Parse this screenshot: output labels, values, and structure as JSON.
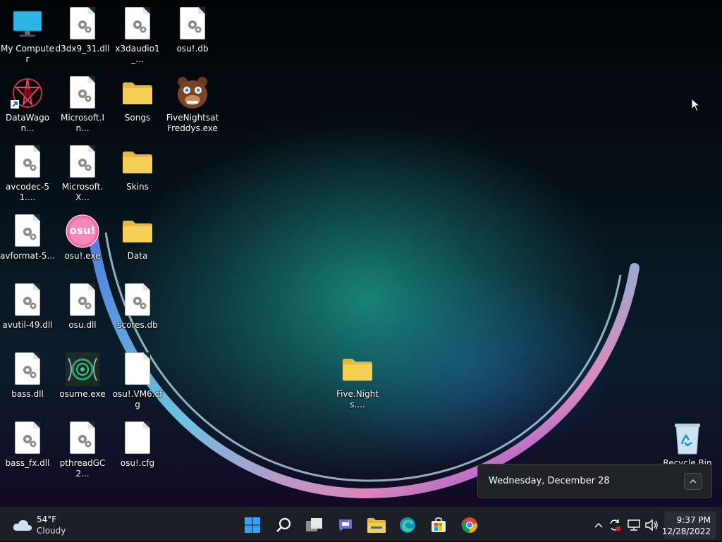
{
  "desktop": {
    "icons": [
      {
        "label": "My Computer"
      },
      {
        "label": "d3dx9_31.dll"
      },
      {
        "label": "x3daudio1_..."
      },
      {
        "label": "osu!.db"
      },
      {
        "label": "DataWagon..."
      },
      {
        "label": "Microsoft.In..."
      },
      {
        "label": "Songs"
      },
      {
        "label": "FiveNightsatFreddys.exe"
      },
      {
        "label": "avcodec-51...."
      },
      {
        "label": "Microsoft.X..."
      },
      {
        "label": "Skins"
      },
      {
        "label": "avformat-5..."
      },
      {
        "label": "osu!.exe"
      },
      {
        "label": "Data"
      },
      {
        "label": "avutil-49.dll"
      },
      {
        "label": "osu.dll"
      },
      {
        "label": "scores.db"
      },
      {
        "label": "bass.dll"
      },
      {
        "label": "osume.exe"
      },
      {
        "label": "osu!.VM6.cfg"
      },
      {
        "label": "bass_fx.dll"
      },
      {
        "label": "pthreadGC2..."
      },
      {
        "label": "osu!.cfg"
      },
      {
        "label": "Five.Nights...."
      },
      {
        "label": "Recycle Bin"
      }
    ],
    "osu_badge": "osu!"
  },
  "flyout": {
    "date": "Wednesday, December 28"
  },
  "taskbar": {
    "weather": {
      "temp": "54°F",
      "condition": "Cloudy"
    },
    "pinned": [
      "start-icon",
      "search-icon",
      "task-view-icon",
      "chat-icon",
      "file-explorer-icon",
      "edge-icon",
      "store-icon",
      "chrome-icon"
    ],
    "clock": {
      "time": "9:37 PM",
      "date": "12/28/2022"
    }
  },
  "colors": {
    "taskbar": "#1c1f24",
    "folder": "#f7cf55",
    "accent": "#0078d4"
  }
}
